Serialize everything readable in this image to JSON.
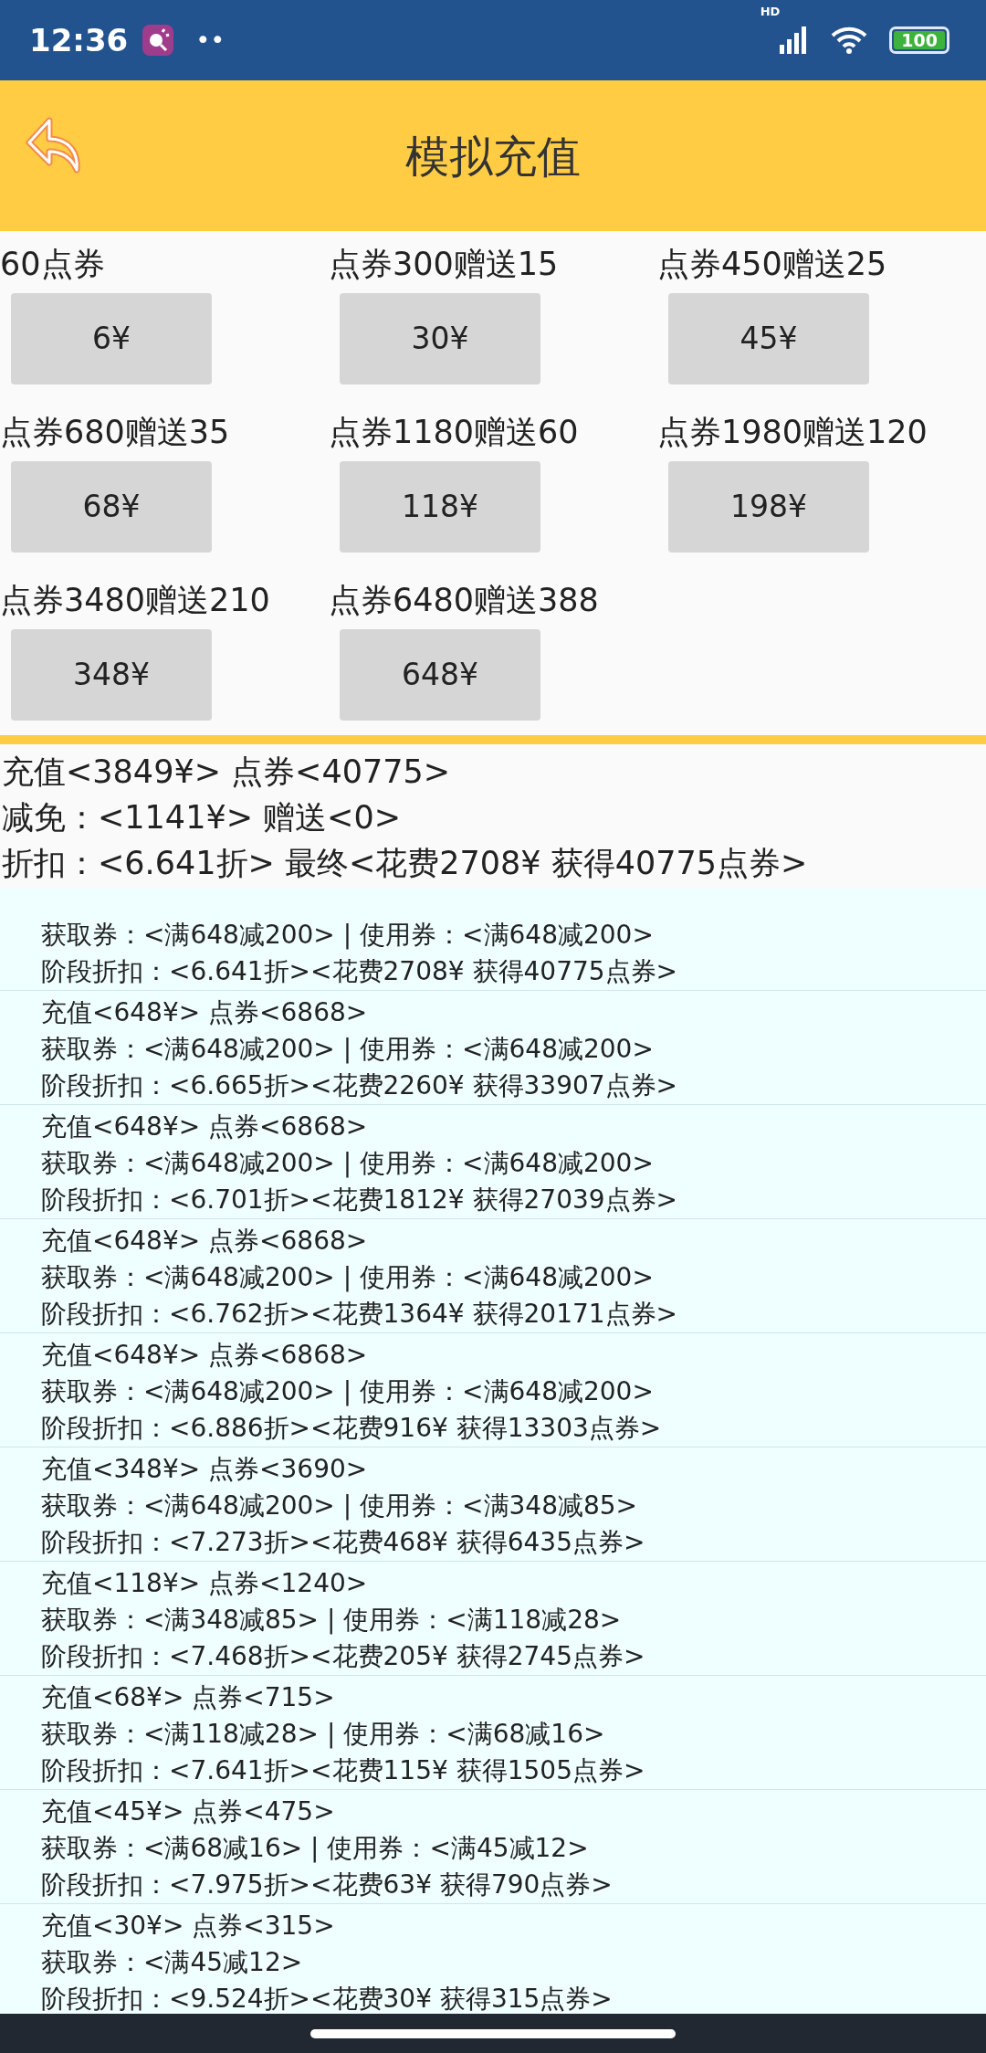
{
  "status_bar": {
    "time": "12:36",
    "dots": "••",
    "network": "HD",
    "battery": "100"
  },
  "header": {
    "title": "模拟充值"
  },
  "packages": [
    {
      "label": "60点券",
      "price": "6¥"
    },
    {
      "label": "点券300赠送15",
      "price": "30¥"
    },
    {
      "label": "点券450赠送25",
      "price": "45¥"
    },
    {
      "label": "点券680赠送35",
      "price": "68¥"
    },
    {
      "label": "点券1180赠送60",
      "price": "118¥"
    },
    {
      "label": "点券1980赠送120",
      "price": "198¥"
    },
    {
      "label": "点券3480赠送210",
      "price": "348¥"
    },
    {
      "label": "点券6480赠送388",
      "price": "648¥"
    }
  ],
  "summary": [
    "充值<3849¥> 点券<40775>",
    "减免：<1141¥> 赠送<0>",
    "折扣：<6.641折> 最终<花费2708¥ 获得40775点券>"
  ],
  "steps": [
    {
      "lines": [
        "获取券：<满648减200> | 使用券：<满648减200>",
        "阶段折扣：<6.641折><花费2708¥ 获得40775点券>"
      ]
    },
    {
      "lines": [
        "充值<648¥> 点券<6868>",
        "获取券：<满648减200> | 使用券：<满648减200>",
        "阶段折扣：<6.665折><花费2260¥ 获得33907点券>"
      ]
    },
    {
      "lines": [
        "充值<648¥> 点券<6868>",
        "获取券：<满648减200> | 使用券：<满648减200>",
        "阶段折扣：<6.701折><花费1812¥ 获得27039点券>"
      ]
    },
    {
      "lines": [
        "充值<648¥> 点券<6868>",
        "获取券：<满648减200> | 使用券：<满648减200>",
        "阶段折扣：<6.762折><花费1364¥ 获得20171点券>"
      ]
    },
    {
      "lines": [
        "充值<648¥> 点券<6868>",
        "获取券：<满648减200> | 使用券：<满648减200>",
        "阶段折扣：<6.886折><花费916¥ 获得13303点券>"
      ]
    },
    {
      "lines": [
        "充值<348¥> 点券<3690>",
        "获取券：<满648减200> | 使用券：<满348减85>",
        "阶段折扣：<7.273折><花费468¥ 获得6435点券>"
      ]
    },
    {
      "lines": [
        "充值<118¥> 点券<1240>",
        "获取券：<满348减85> | 使用券：<满118减28>",
        "阶段折扣：<7.468折><花费205¥ 获得2745点券>"
      ]
    },
    {
      "lines": [
        "充值<68¥> 点券<715>",
        "获取券：<满118减28> | 使用券：<满68减16>",
        "阶段折扣：<7.641折><花费115¥ 获得1505点券>"
      ]
    },
    {
      "lines": [
        "充值<45¥> 点券<475>",
        "获取券：<满68减16> | 使用券：<满45减12>",
        "阶段折扣：<7.975折><花费63¥ 获得790点券>"
      ]
    },
    {
      "lines": [
        "充值<30¥> 点券<315>",
        "获取券：<满45减12>",
        "阶段折扣：<9.524折><花费30¥ 获得315点券>"
      ]
    }
  ]
}
